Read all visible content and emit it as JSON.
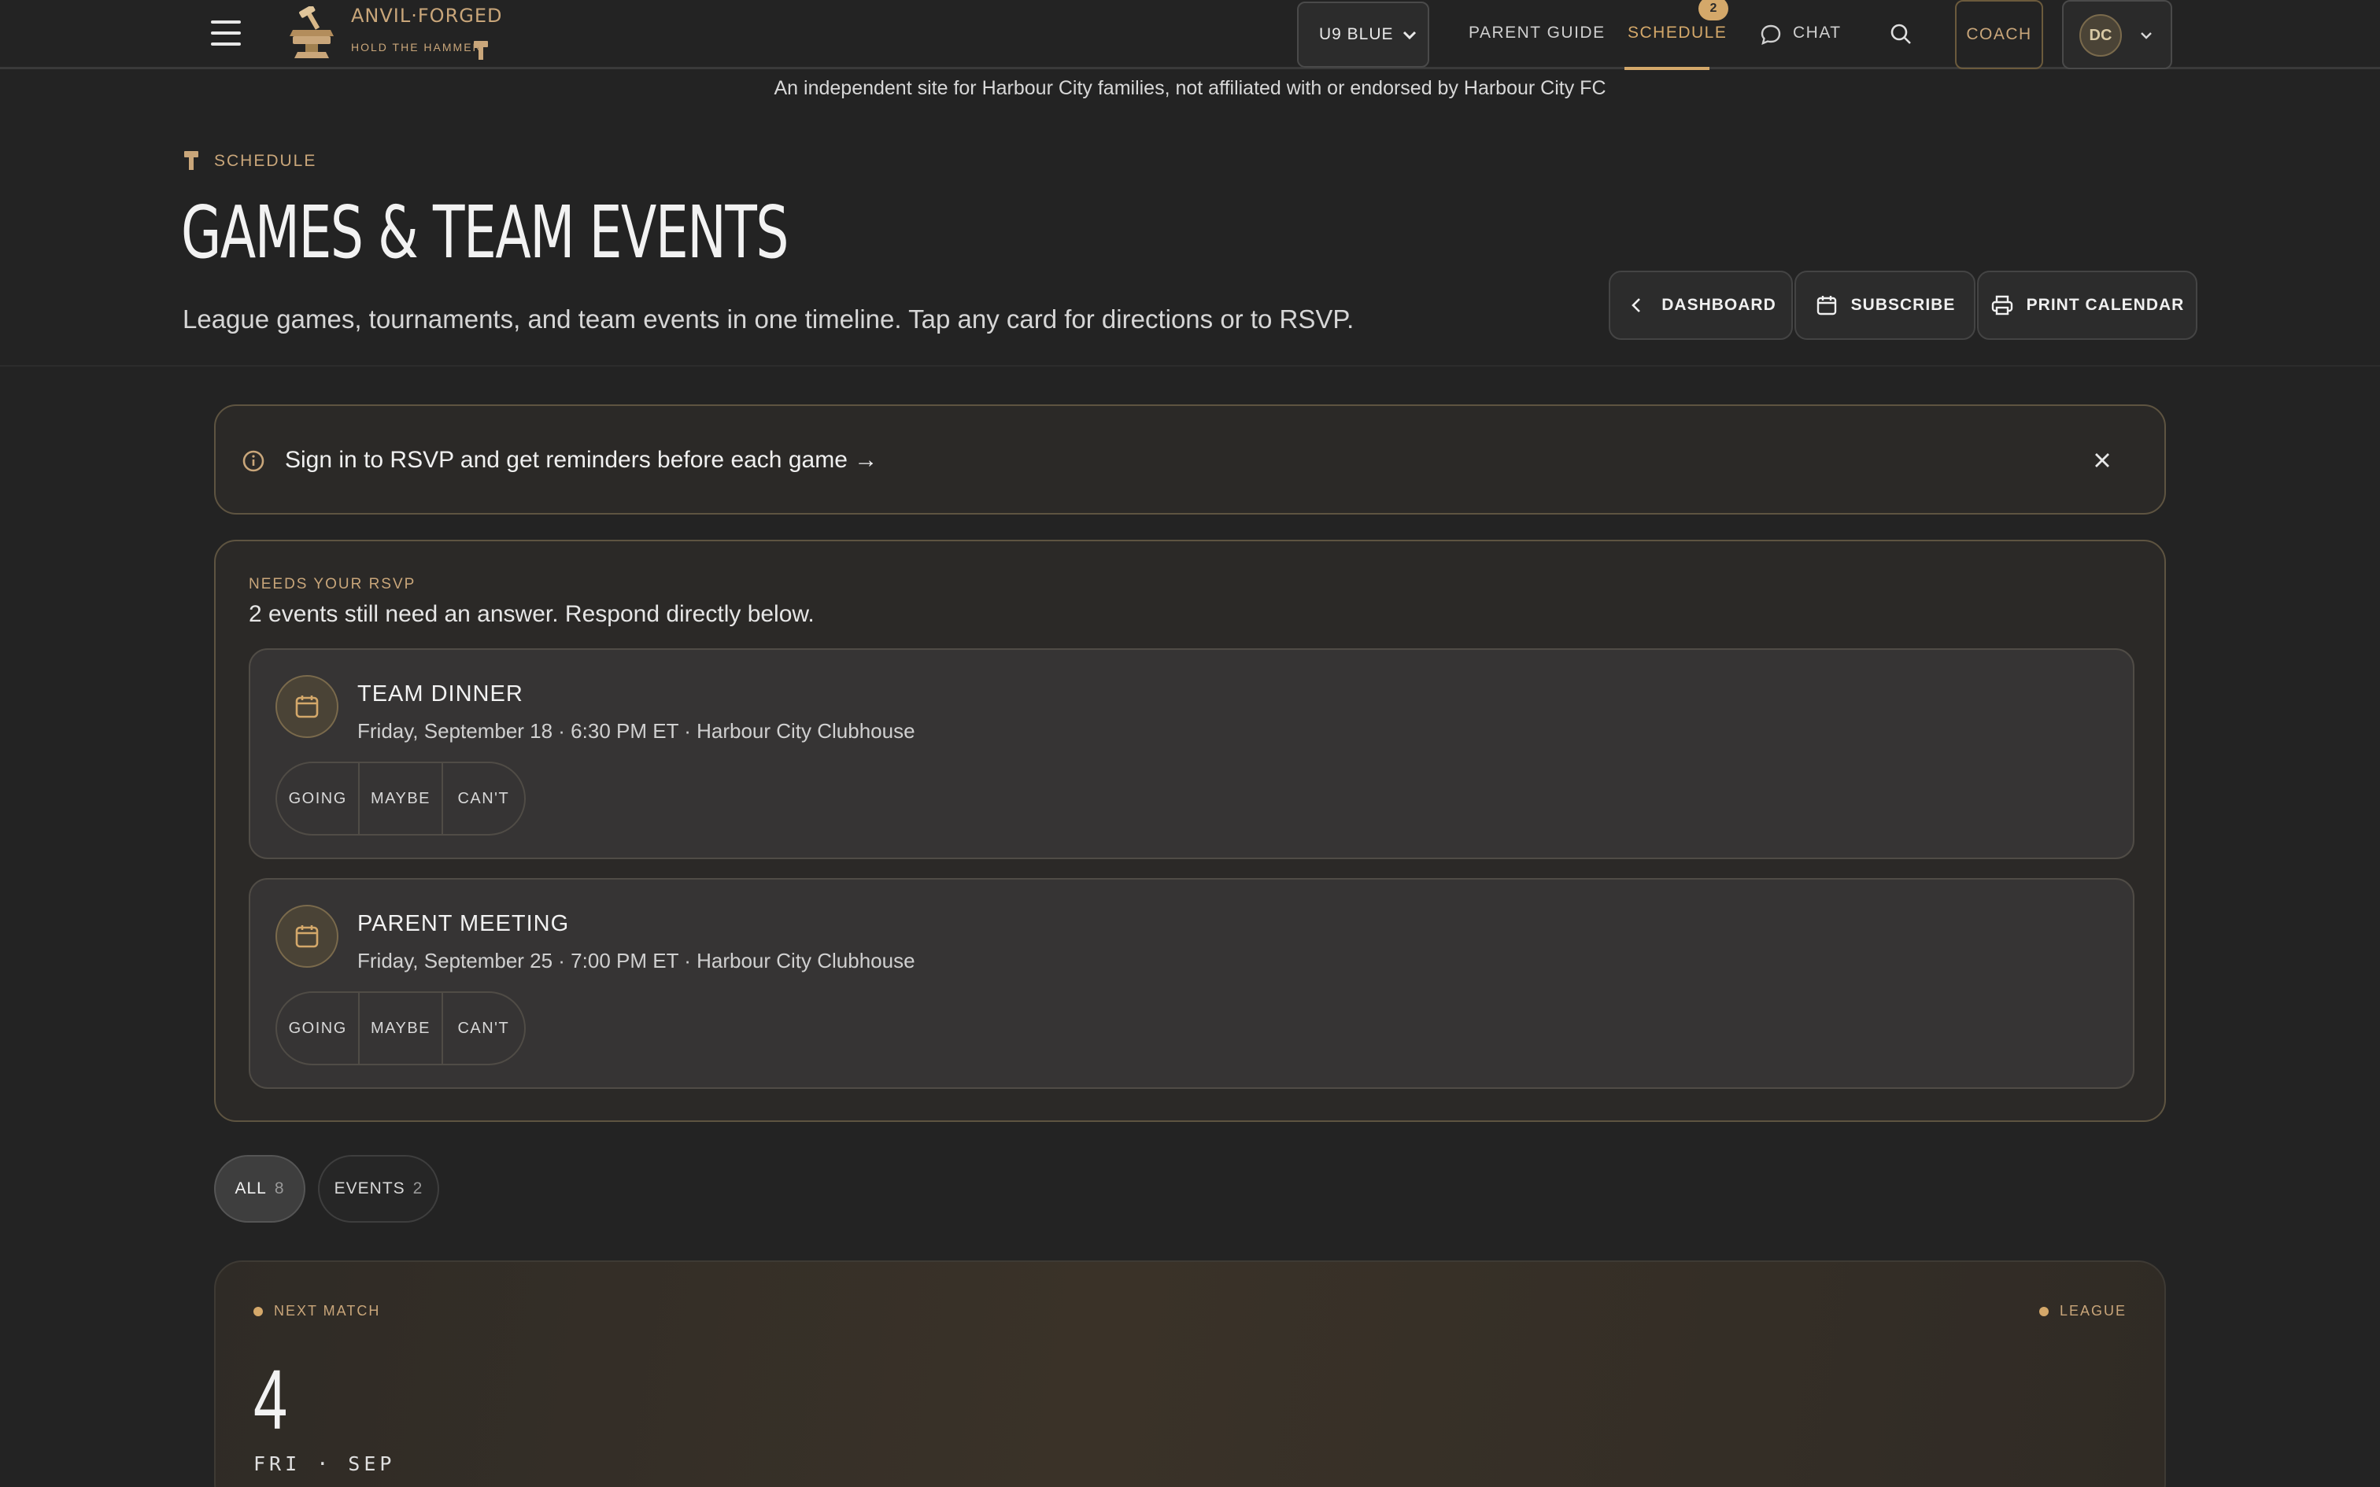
{
  "header": {
    "brand_name": "ANVIL·FORGED",
    "brand_tagline": "HOLD THE HAMMER",
    "team_select": "U9 BLUE",
    "nav": {
      "parent_guide": "PARENT GUIDE",
      "schedule": "SCHEDULE",
      "schedule_badge": "2",
      "chat": "CHAT"
    },
    "coach_label": "COACH",
    "user_initials": "DC"
  },
  "disclaimer": "An independent site for Harbour City families, not affiliated with or endorsed by Harbour City FC",
  "page": {
    "eyebrow": "SCHEDULE",
    "title": "GAMES & TEAM EVENTS",
    "subtitle": "League games, tournaments, and team events in one timeline. Tap any card for directions or to RSVP.",
    "buttons": {
      "dashboard": "DASHBOARD",
      "subscribe": "SUBSCRIBE",
      "print": "PRINT CALENDAR"
    }
  },
  "banner": {
    "text": "Sign in to RSVP and get reminders before each game →"
  },
  "rsvp": {
    "eyebrow": "NEEDS YOUR RSVP",
    "description": "2 events still need an answer. Respond directly below.",
    "options": [
      "GOING",
      "MAYBE",
      "CAN'T"
    ],
    "events": [
      {
        "title": "TEAM DINNER",
        "meta": "Friday, September 18 · 6:30 PM ET · Harbour City Clubhouse"
      },
      {
        "title": "PARENT MEETING",
        "meta": "Friday, September 25 · 7:00 PM ET · Harbour City Clubhouse"
      }
    ]
  },
  "filters": [
    {
      "label": "ALL",
      "count": "8",
      "active": true
    },
    {
      "label": "EVENTS",
      "count": "2",
      "active": false
    }
  ],
  "next_match": {
    "label": "NEXT MATCH",
    "type": "LEAGUE",
    "day": "4",
    "weekday_month": "FRI · SEP"
  },
  "colors": {
    "background": "#232323",
    "accent": "#d4a86a",
    "card": "#2b2927",
    "card_border": "#5e5441"
  }
}
